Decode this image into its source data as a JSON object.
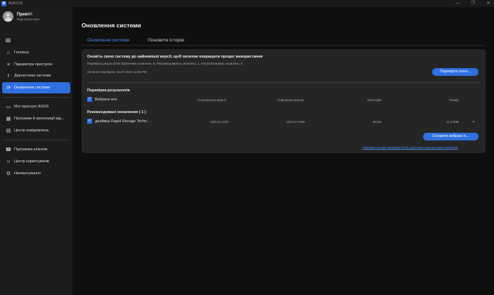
{
  "window": {
    "app_title": "MyASUS",
    "logo_letter": "M",
    "controls": {
      "minimize": "—",
      "maximize": "❐",
      "close": "✕"
    }
  },
  "profile": {
    "greeting": "Привіт!",
    "subtitle": "Раді вітати вас!"
  },
  "sidebar": {
    "items": [
      {
        "label": "Головна",
        "icon": "home-icon",
        "glyph": "⌂"
      },
      {
        "label": "Параметри пристрою",
        "icon": "sliders-icon",
        "glyph": "≡"
      },
      {
        "label": "Діагностика системи",
        "icon": "diagnostics-icon",
        "glyph": "⚕"
      },
      {
        "label": "Оновлення системи",
        "icon": "refresh-icon",
        "glyph": "⟳",
        "active": true
      },
      {
        "label": "Мої пристрої ASUS",
        "icon": "devices-icon",
        "glyph": "▭"
      },
      {
        "label": "Програми й пропозиції від...",
        "icon": "apps-icon",
        "glyph": "▦"
      },
      {
        "label": "Центр повідомлень",
        "icon": "message-icon",
        "glyph": "▤"
      },
      {
        "label": "Підтримка клієнтів",
        "icon": "headset-icon",
        "glyph": "☎"
      },
      {
        "label": "Центр користувачів",
        "icon": "user-icon",
        "glyph": "☺"
      },
      {
        "label": "Налаштування",
        "icon": "gear-icon",
        "glyph": "⚙"
      }
    ]
  },
  "main": {
    "title": "Оновлення системи",
    "tabs": [
      {
        "label": "Оновлення системи",
        "active": true
      },
      {
        "label": "Поновити історію",
        "active": false
      }
    ],
    "card": {
      "heading": "Оновіть свою систему до найновішої версії, щоб загалом покращити процес використання",
      "summary": "Перевірка результатів: Критичних оновлень: 0, Рекомендованих оновлень: 1, Необов'язкових оновлень: 0",
      "last_check": "Остання перевірка: 01.07.2024   11:55 PM",
      "check_button": "Перевірте поно...",
      "results_title": "Перевірка результатів",
      "select_all": "Вибрати все",
      "columns": [
        "Установлена версія",
        "Найновіша версія",
        "Категорія",
        "Розмір"
      ],
      "recommended_title": "Рекомендовані оновлення ( 1 )",
      "rows": [
        {
          "name": "драйвер Rapid Storage Techn...",
          "installed": "V20.0.0.1037",
          "latest": "V20.0.0.1038",
          "category": "Driver",
          "size": "11,17MB"
        }
      ],
      "update_button": "Оновити вибрані е...",
      "link_text": "Перейдіть на сайт підтримки ASUS, щоб знайти інші доступні оновлення"
    }
  },
  "colors": {
    "accent": "#2f6fe0",
    "background": "#0f0f0f",
    "sidebar": "#1c1c1c",
    "card": "#252525"
  }
}
